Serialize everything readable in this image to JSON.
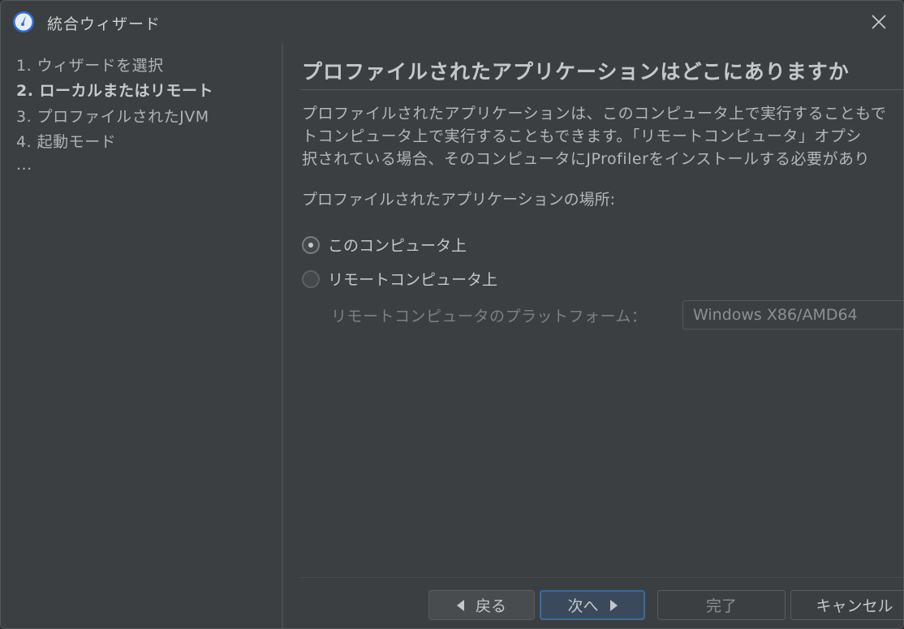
{
  "window": {
    "title": "統合ウィザード"
  },
  "sidebar": {
    "steps": [
      {
        "label": "1. ウィザードを選択",
        "active": false
      },
      {
        "label": "2. ローカルまたはリモート",
        "active": true
      },
      {
        "label": "3. プロファイルされたJVM",
        "active": false
      },
      {
        "label": "4. 起動モード",
        "active": false
      },
      {
        "label": "...",
        "active": false
      }
    ]
  },
  "main": {
    "heading": "プロファイルされたアプリケーションはどこにありますか",
    "description": [
      "プロファイルされたアプリケーションは、このコンピュータ上で実行することもで",
      "トコンピュータ上で実行することもできます。「リモートコンピュータ」オプシ",
      "択されている場合、そのコンピュータにJProfilerをインストールする必要があり"
    ],
    "location_label": "プロファイルされたアプリケーションの場所:",
    "options": [
      {
        "label": "このコンピュータ上",
        "checked": true
      },
      {
        "label": "リモートコンピュータ上",
        "checked": false
      }
    ],
    "platform_label": "リモートコンピュータのプラットフォーム：",
    "platform_value": "Windows X86/AMD64"
  },
  "footer": {
    "back_label": "戻る",
    "next_label": "次へ",
    "finish_label": "完了",
    "cancel_label": "キャンセル"
  },
  "colors": {
    "background": "#3c3f41",
    "accent": "#3d6a9c"
  }
}
